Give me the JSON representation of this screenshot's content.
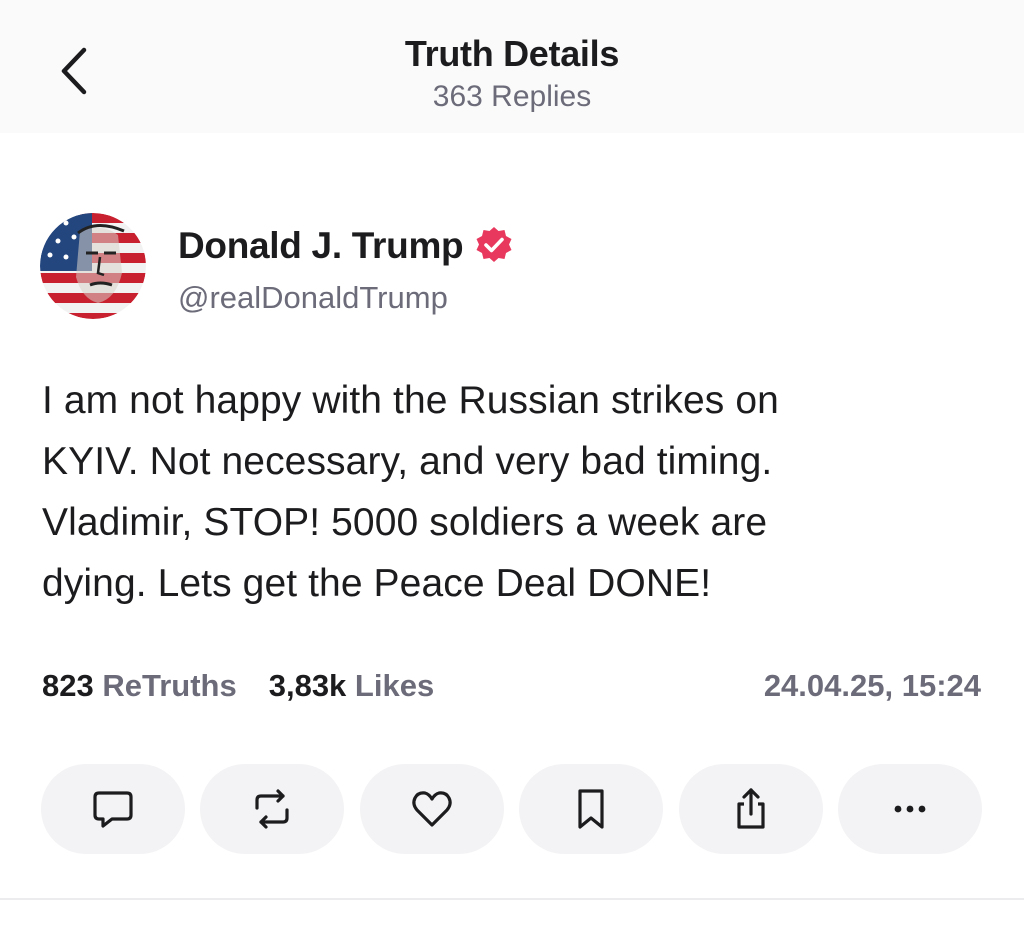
{
  "header": {
    "title": "Truth Details",
    "replies_label": "363 Replies"
  },
  "author": {
    "name": "Donald J. Trump",
    "handle": "@realDonaldTrump",
    "verified": true,
    "verified_color": "#e8385e"
  },
  "post": {
    "text": "I am not happy with the Russian strikes on\nKYIV. Not necessary, and very bad timing.\nVladimir, STOP! 5000 soldiers a week are\ndying. Lets get the Peace Deal DONE!"
  },
  "stats": {
    "retruths_count": "823",
    "retruths_label": "ReTruths",
    "likes_count": "3,83k",
    "likes_label": "Likes",
    "timestamp": "24.04.25, 15:24"
  },
  "actions": [
    {
      "name": "reply",
      "icon": "comment-icon"
    },
    {
      "name": "retruth",
      "icon": "repost-icon"
    },
    {
      "name": "like",
      "icon": "heart-icon"
    },
    {
      "name": "bookmark",
      "icon": "bookmark-icon"
    },
    {
      "name": "share",
      "icon": "share-icon"
    },
    {
      "name": "more",
      "icon": "more-icon"
    }
  ],
  "colors": {
    "text_primary": "#1c1c1f",
    "text_secondary": "#6b6b7a",
    "action_bg": "#f3f3f5",
    "header_bg": "#fafafa"
  }
}
